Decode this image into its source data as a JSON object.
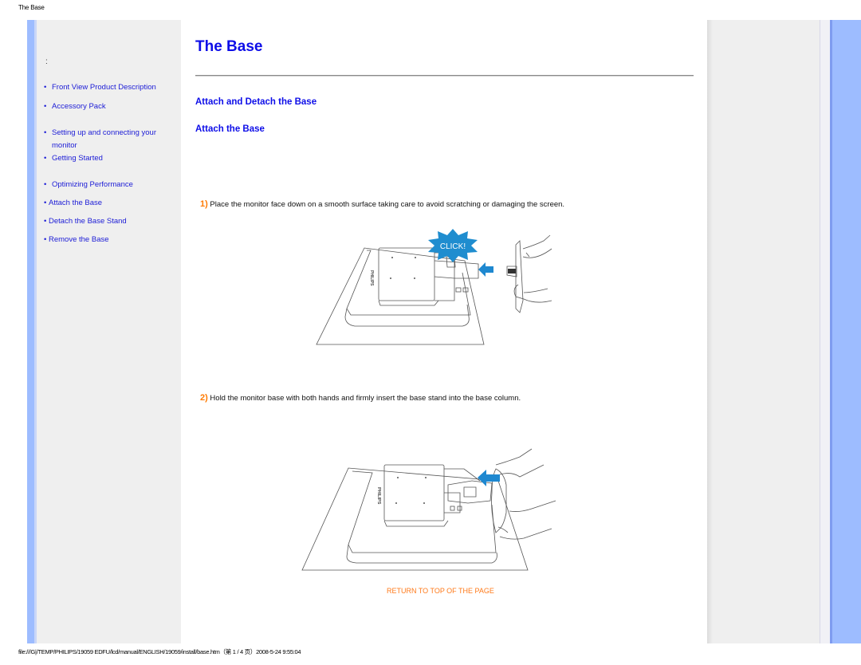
{
  "page_header": "The Base",
  "sidebar": {
    "colon": ":",
    "items": [
      {
        "label": "Front View Product Description",
        "bullet": "•"
      },
      {
        "label": "Accessory Pack",
        "bullet": "•"
      },
      {
        "label": "Setting up and connecting your",
        "label2": "monitor",
        "bullet": "•"
      },
      {
        "label": "Getting Started",
        "bullet": "•"
      },
      {
        "label": "Optimizing Performance",
        "bullet": "•"
      },
      {
        "label": "Attach the Base",
        "bullet": "•"
      },
      {
        "label": "Detach the Base Stand",
        "bullet": "•"
      },
      {
        "label": "Remove the Base",
        "bullet": "•"
      }
    ]
  },
  "main": {
    "title": "The Base",
    "section_heading": "Attach and Detach the Base",
    "subsection_heading": "Attach the Base",
    "steps": [
      {
        "num": "1)",
        "text": " Place the monitor face down on a smooth surface taking care to avoid scratching or damaging the screen."
      },
      {
        "num": "2)",
        "text": " Hold the monitor base with both hands and firmly insert the base stand into the base column."
      }
    ],
    "figure1": {
      "badge": "CLICK!",
      "arrow_color": "#1e88d0",
      "brand": "PHILIPS"
    },
    "figure2": {
      "arrow_color": "#1e88d0",
      "brand": "PHILIPS"
    },
    "return_link": "RETURN TO TOP OF THE PAGE"
  },
  "footer": "file:///G|/TEMP/PHILIPS/19059 EDFU/lcd/manual/ENGLISH/19059/install/base.htm（第 1 / 4 页）2008-5-24 9:55:04"
}
